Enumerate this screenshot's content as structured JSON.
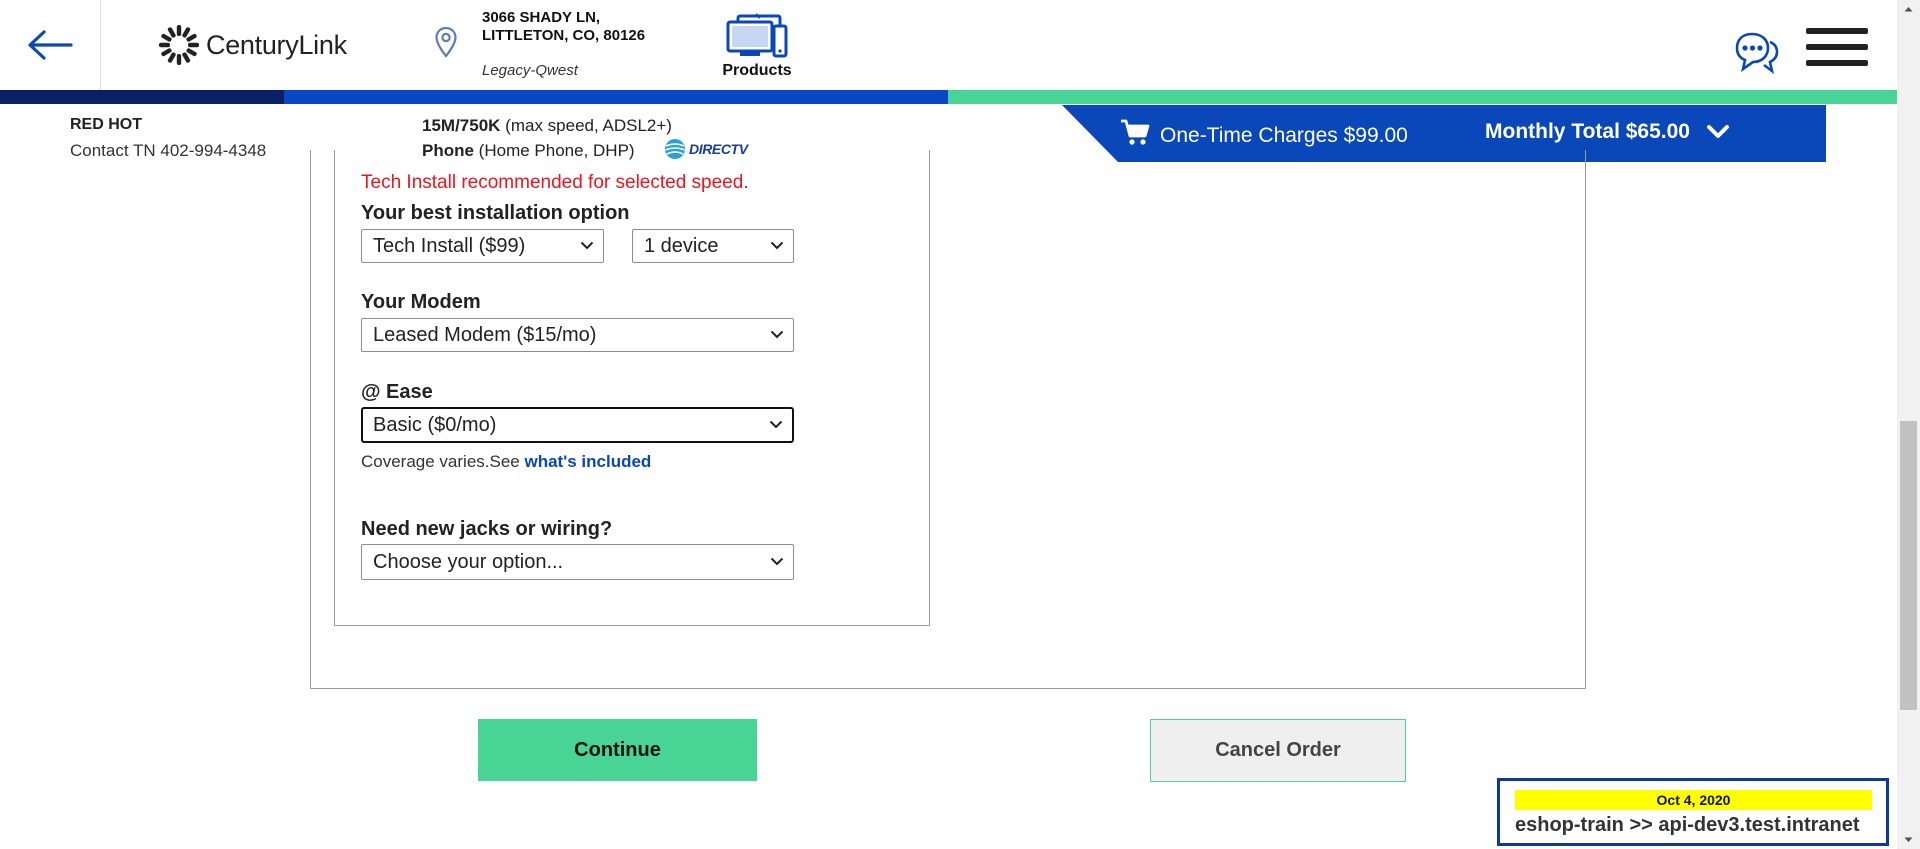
{
  "header": {
    "brand": "CenturyLink",
    "address_line1": "3066 SHADY LN,",
    "address_line2": "LITTLETON, CO, 80126",
    "region": "Legacy-Qwest",
    "products_label": "Products"
  },
  "progress": {
    "colors": {
      "done": "#0b1f66",
      "current": "#0a47c6",
      "remaining": "#47d494"
    }
  },
  "info": {
    "customer_label": "RED HOT",
    "contact": "Contact TN 402-994-4348",
    "speed_bold": "15M/750K",
    "speed_rest": " (max speed, ADSL2+)",
    "phone_bold": "Phone",
    "phone_rest": " (Home Phone, DHP)",
    "partner": "DIRECTV"
  },
  "cart": {
    "one_time": "One-Time Charges $99.00",
    "monthly": "Monthly Total $65.00",
    "banner_color": "#0a47b8"
  },
  "form": {
    "warning": "Tech Install recommended for selected speed.",
    "install_label": "Your best installation option",
    "install_value": "Tech Install ($99)",
    "device_value": "1 device",
    "modem_label": "Your Modem",
    "modem_value": "Leased Modem ($15/mo)",
    "ease_label": "@ Ease",
    "ease_value": "Basic ($0/mo)",
    "coverage_text": "Coverage varies.See ",
    "coverage_link": "what's included",
    "jacks_label": "Need new jacks or wiring?",
    "jacks_value": "Choose your option..."
  },
  "actions": {
    "continue": "Continue",
    "cancel": "Cancel Order"
  },
  "env": {
    "date": "Oct 4, 2020",
    "text": "eshop-train >> api-dev3.test.intranet"
  }
}
